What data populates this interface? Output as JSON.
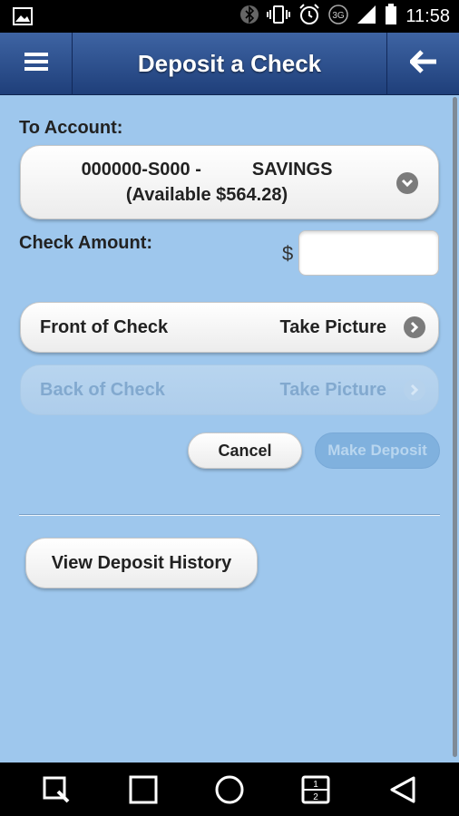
{
  "status_bar": {
    "time": "11:58",
    "icons": [
      "image-icon",
      "bluetooth-icon",
      "vibrate-icon",
      "alarm-icon",
      "3g-icon",
      "signal-icon",
      "battery-icon"
    ]
  },
  "header": {
    "title": "Deposit a Check",
    "menu_icon": "menu-icon",
    "back_icon": "back-arrow-icon",
    "color": "#2d5293"
  },
  "form": {
    "to_account_label": "To Account:",
    "account": {
      "number": "000000-S000 -",
      "type": "SAVINGS",
      "available": "(Available $564.28)"
    },
    "check_amount_label": "Check Amount:",
    "currency_symbol": "$",
    "amount_value": "",
    "front_of_check": {
      "label": "Front of Check",
      "action": "Take Picture"
    },
    "back_of_check": {
      "label": "Back of Check",
      "action": "Take Picture",
      "enabled": false
    },
    "cancel_label": "Cancel",
    "make_deposit_label": "Make Deposit",
    "view_history_label": "View Deposit History"
  },
  "nav_bar": {
    "icons": [
      "recents-search-icon",
      "home-square-icon",
      "circle-home-icon",
      "split-screen-icon",
      "back-triangle-icon"
    ]
  },
  "colors": {
    "background": "#9ec7ed",
    "header": "#2d5293",
    "disabled_text": "#82a9cf"
  }
}
